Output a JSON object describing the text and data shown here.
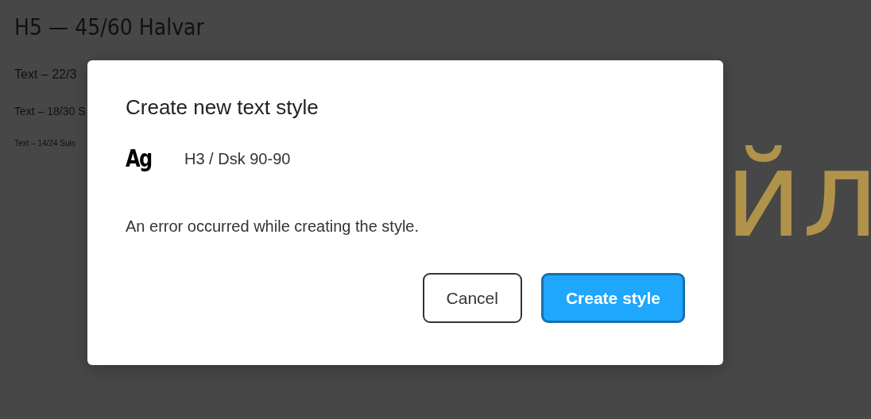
{
  "background": {
    "heading": "H5 — 45/60 Halvar",
    "text_samples": [
      "Text – 22/3",
      "Text – 18/30 S",
      "Text – 14/24 Suis"
    ],
    "large_text": "йл"
  },
  "dialog": {
    "title": "Create new text style",
    "style_preview": {
      "sample": "Ag",
      "name": "H3 / Dsk 90-90"
    },
    "message": "An error occurred while creating the style.",
    "buttons": [
      {
        "label": "Cancel",
        "kind": "secondary"
      },
      {
        "label": "Create style",
        "kind": "primary"
      }
    ]
  }
}
